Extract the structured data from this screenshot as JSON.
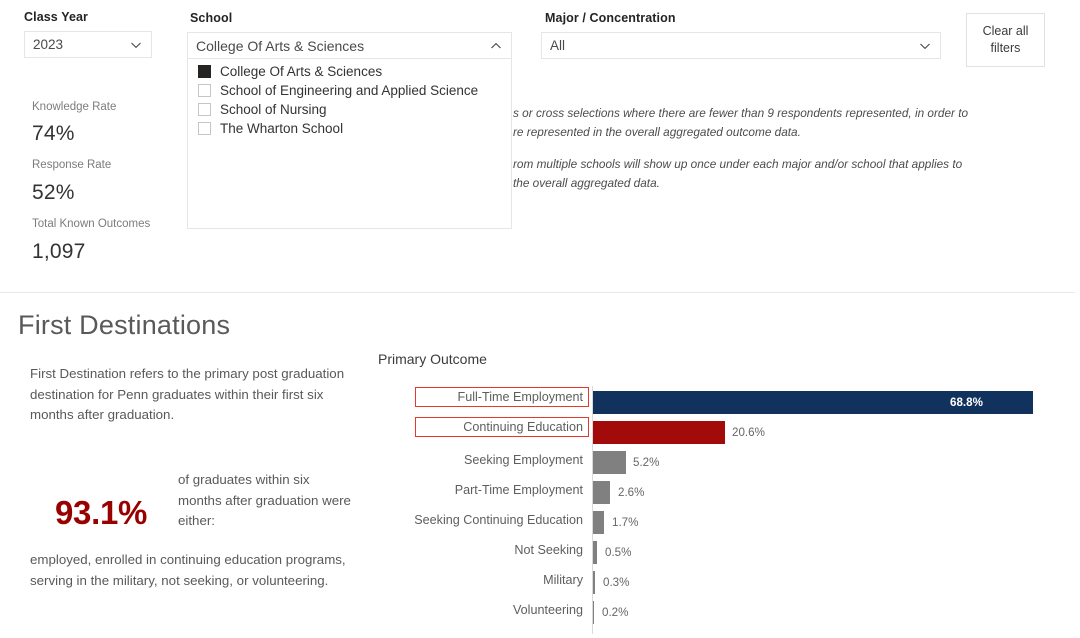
{
  "filters": {
    "class_year": {
      "label": "Class Year",
      "value": "2023",
      "icon": "chevron-down-icon"
    },
    "school": {
      "label": "School",
      "value": "College Of Arts & Sciences",
      "icon": "chevron-up-icon",
      "expanded": true,
      "options": [
        {
          "label": "College Of Arts & Sciences",
          "checked": true
        },
        {
          "label": "School of Engineering and Applied Science",
          "checked": false
        },
        {
          "label": "School of Nursing",
          "checked": false
        },
        {
          "label": "The Wharton School",
          "checked": false
        }
      ]
    },
    "major": {
      "label": "Major / Concentration",
      "value": "All",
      "icon": "chevron-down-icon"
    },
    "clear_all": "Clear all\nfilters"
  },
  "kpis": [
    {
      "label": "Knowledge Rate",
      "value": "74%"
    },
    {
      "label": "Response Rate",
      "value": "52%"
    },
    {
      "label": "Total Known Outcomes",
      "value": "1,097"
    }
  ],
  "notes": [
    "s or cross selections where there are fewer than 9 respondents represented, in order to",
    "re represented in the overall aggregated outcome data.",
    "rom multiple schools will show up once under each major and/or school that applies to",
    "the overall aggregated data."
  ],
  "destinations": {
    "title": "First Destinations",
    "intro": "First Destination refers to the primary post graduation destination for Penn graduates within their first six months after graduation.",
    "stat": "93.1%",
    "stat_text": "of graduates within six months after graduation were either:",
    "outro": "employed, enrolled in continuing education programs, serving in the military, not seeking, or volunteering."
  },
  "chart_data": {
    "type": "bar",
    "orientation": "horizontal",
    "title": "Primary Outcome",
    "xlabel": "",
    "ylabel": "",
    "grid": false,
    "legend": "none",
    "xlim": [
      0,
      68.8
    ],
    "categories": [
      "Full-Time Employment",
      "Continuing Education",
      "Seeking Employment",
      "Part-Time Employment",
      "Seeking Continuing Education",
      "Not Seeking",
      "Military",
      "Volunteering"
    ],
    "values": [
      68.8,
      20.6,
      5.2,
      2.6,
      1.7,
      0.5,
      0.3,
      0.2
    ],
    "value_labels": [
      "68.8%",
      "20.6%",
      "5.2%",
      "2.6%",
      "1.7%",
      "0.5%",
      "0.3%",
      "0.2%"
    ],
    "colors": [
      "#12325e",
      "#a30b0b",
      "#808080",
      "#808080",
      "#808080",
      "#808080",
      "#808080",
      "#808080"
    ],
    "label_inside": [
      true,
      false,
      false,
      false,
      false,
      false,
      false,
      false
    ],
    "selected": [
      "Full-Time Employment",
      "Continuing Education"
    ],
    "selection_color": "#e8372c"
  },
  "theme": {
    "navy": "#12325e",
    "crimson": "#a30b0b",
    "gray_bar": "#808080",
    "penn_red": "#990000",
    "selection": "#e8372c"
  }
}
